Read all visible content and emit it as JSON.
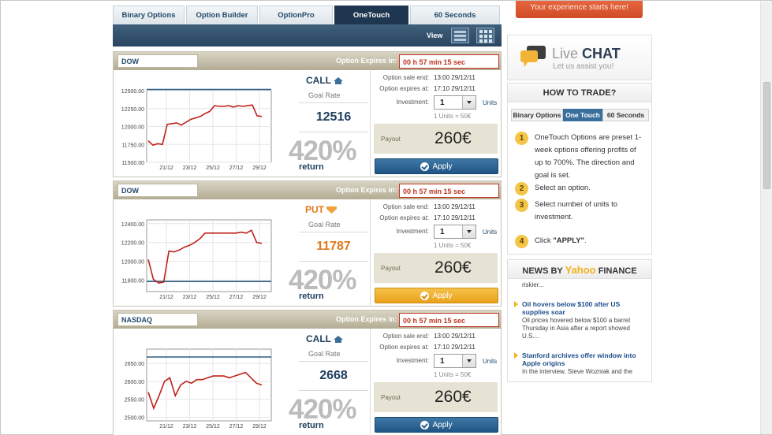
{
  "tabs": [
    {
      "label": "Binary Options",
      "active": false
    },
    {
      "label": "Option Builder",
      "active": false
    },
    {
      "label": "OptionPro",
      "active": false
    },
    {
      "label": "OneTouch",
      "active": true
    },
    {
      "label": "60 Seconds",
      "active": false
    }
  ],
  "view": {
    "label": "View",
    "icons": [
      "list-view-icon",
      "grid-view-icon"
    ]
  },
  "common": {
    "expires_label": "Option Expires in:",
    "goal_label": "Goal Rate",
    "sale_end_label": "Option sale end:",
    "expires_at_label": "Option expires at:",
    "investment_label": "Investment:",
    "units_label": "Units",
    "units_equation": "1 Units = 50€",
    "payout_label": "Payout",
    "return_label": "return",
    "apply_label": "Apply"
  },
  "options": [
    {
      "asset": "DOW",
      "expires_in": "00 h 57 min 15 sec",
      "direction": "CALL",
      "goal_rate": "12516",
      "percent": "420%",
      "sale_end": "13:00 29/12/11",
      "expires_at": "17:10 29/12/11",
      "investment": "1",
      "payout": "260€",
      "chart_data": {
        "type": "line",
        "x_ticks": [
          "21/12",
          "23/12",
          "25/12",
          "27/12",
          "29/12"
        ],
        "y_ticks": [
          "12500.00",
          "12250.00",
          "12000.00",
          "11750.00",
          "11500.00"
        ],
        "ylim": [
          11500,
          12500
        ],
        "goal_line": 12516,
        "series": [
          {
            "values": [
              11800,
              11740,
              11760,
              11750,
              12030,
              12040,
              12050,
              12020,
              12060,
              12100,
              12120,
              12140,
              12180,
              12210,
              12290,
              12280,
              12280,
              12290,
              12270,
              12290,
              12280,
              12290,
              12300,
              12150,
              12140
            ]
          }
        ]
      }
    },
    {
      "asset": "DOW",
      "expires_in": "00 h 57 min 15 sec",
      "direction": "PUT",
      "goal_rate": "11787",
      "percent": "420%",
      "sale_end": "13:00 29/12/11",
      "expires_at": "17:10 29/12/11",
      "investment": "1",
      "payout": "260€",
      "chart_data": {
        "type": "line",
        "x_ticks": [
          "21/12",
          "23/12",
          "25/12",
          "27/12",
          "29/12"
        ],
        "y_ticks": [
          "12400.00",
          "12200.00",
          "12000.00",
          "11800.00"
        ],
        "ylim": [
          11680,
          12440
        ],
        "goal_line": 11787,
        "series": [
          {
            "values": [
              12020,
              11810,
              11770,
              11780,
              12110,
              12100,
              12120,
              12150,
              12170,
              12200,
              12240,
              12300,
              12300,
              12300,
              12300,
              12300,
              12300,
              12300,
              12310,
              12300,
              12330,
              12200,
              12190
            ]
          }
        ]
      }
    },
    {
      "asset": "NASDAQ",
      "expires_in": "00 h 57 min 15 sec",
      "direction": "CALL",
      "goal_rate": "2668",
      "percent": "420%",
      "sale_end": "13:00 29/12/11",
      "expires_at": "17:10 29/12/11",
      "investment": "1",
      "payout": "260€",
      "chart_data": {
        "type": "line",
        "x_ticks": [
          "21/12",
          "23/12",
          "25/12",
          "27/12",
          "29/12"
        ],
        "y_ticks": [
          "2650.00",
          "2600.00",
          "2550.00",
          "2500.00"
        ],
        "ylim": [
          2490,
          2690
        ],
        "goal_line": 2668,
        "series": [
          {
            "values": [
              2570,
              2525,
              2560,
              2600,
              2610,
              2560,
              2590,
              2600,
              2595,
              2605,
              2605,
              2610,
              2615,
              2615,
              2615,
              2610,
              2615,
              2620,
              2625,
              2610,
              2595,
              2590
            ]
          }
        ]
      }
    }
  ],
  "sidebar": {
    "promo": "Your experience starts here!",
    "chat_title_light": "Live",
    "chat_title_bold": "CHAT",
    "chat_sub": "Let us assist you!",
    "howto_title": "HOW TO TRADE?",
    "howto_tabs": [
      "Binary Options",
      "One Touch",
      "60 Seconds"
    ],
    "steps": [
      {
        "num": "1",
        "text": "OneTouch Options are preset 1-week options offering profits of up to 700%.  The direction and goal is set."
      },
      {
        "num": "2",
        "text": "Select an option."
      },
      {
        "num": "3",
        "text": "Select number of units to investment."
      },
      {
        "num": "4",
        "text_pre": "Click ",
        "text_bold": "\"APPLY\"",
        "text_post": "."
      }
    ],
    "news_title_pre": "NEWS BY",
    "news_title_brand": "Yahoo",
    "news_title_post": "FINANCE",
    "news_fragment": "riskier...",
    "news": [
      {
        "headline": "Oil hovers below $100 after US supplies soar",
        "body": "Oil prices hovered below $100 a barrel Thursday in Asia after a report showed U.S...."
      },
      {
        "headline": "Stanford archives offer window into Apple origins",
        "body": "In the interview, Steve Wozniak and the"
      }
    ]
  },
  "colors": {
    "navy": "#1e3650",
    "call_blue": "#1e3e5e",
    "put_orange": "#e07818",
    "line_red": "#c0201a",
    "goal_line": "#2e5b82"
  }
}
